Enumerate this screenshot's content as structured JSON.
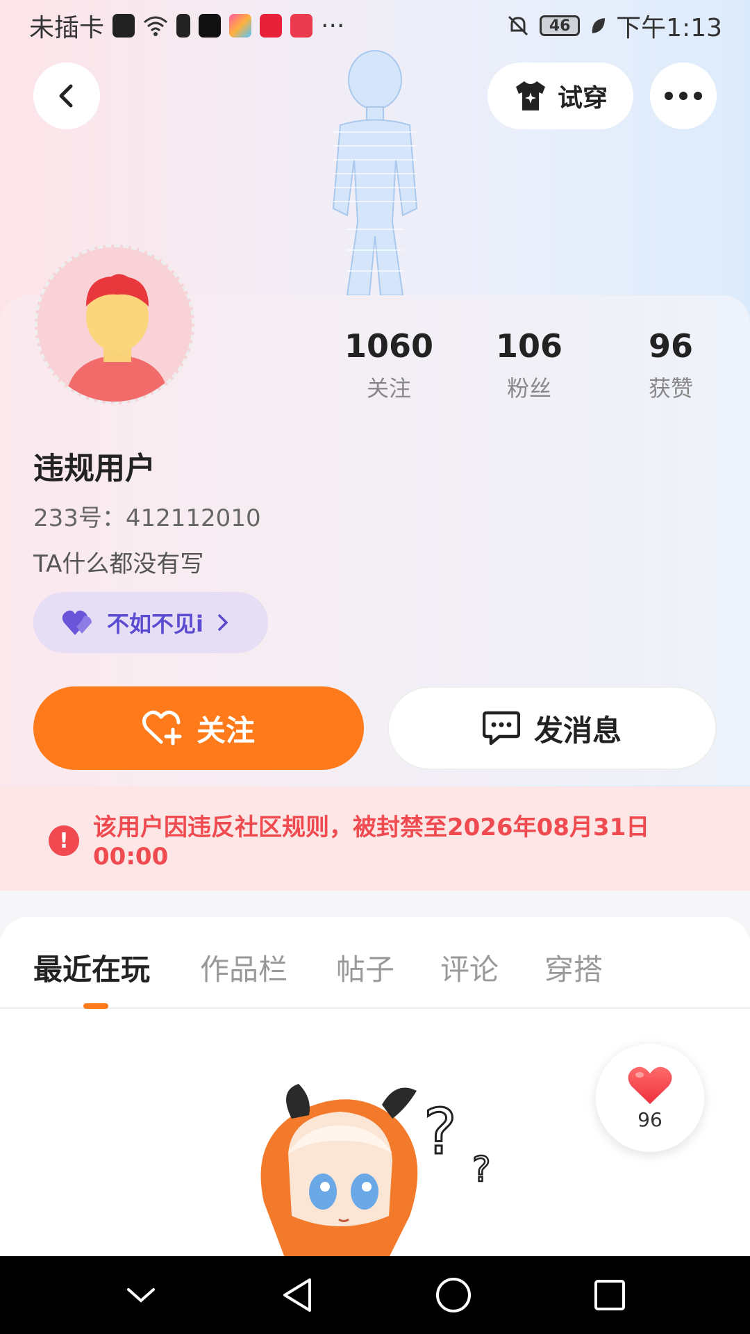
{
  "status_bar": {
    "carrier": "未插卡",
    "more": "···",
    "battery": "46",
    "time": "下午1:13"
  },
  "header": {
    "tryon_label": "试穿"
  },
  "profile": {
    "stats": [
      {
        "value": "1060",
        "label": "关注"
      },
      {
        "value": "106",
        "label": "粉丝"
      },
      {
        "value": "96",
        "label": "获赞"
      }
    ],
    "username": "违规用户",
    "id_text": "233号：412112010",
    "bio": "TA什么都没有写",
    "badge": "不如不见i"
  },
  "actions": {
    "follow": "关注",
    "message": "发消息"
  },
  "ban_notice": {
    "text": "该用户因违反社区规则，被封禁至2026年08月31日 00:00"
  },
  "tabs": [
    "最近在玩",
    "作品栏",
    "帖子",
    "评论",
    "穿搭"
  ],
  "like_bubble": {
    "count": "96"
  },
  "colors": {
    "accent": "#ff7a1a",
    "ban_red": "#ef4a4f",
    "badge_purple": "#5b4bd1"
  }
}
